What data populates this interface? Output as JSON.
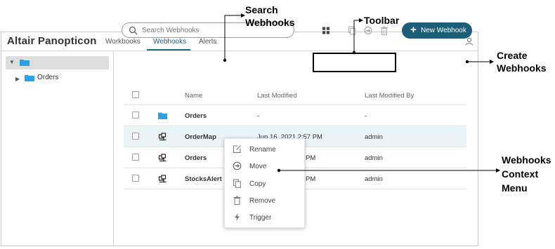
{
  "header": {
    "brand": "Altair Panopticon",
    "tabs": [
      {
        "label": "Workbooks",
        "active": false
      },
      {
        "label": "Webhooks",
        "active": true
      },
      {
        "label": "Alerts",
        "active": false
      }
    ],
    "user_icon": "user-icon"
  },
  "sidebar": {
    "root_icon": "folder-icon",
    "items": [
      {
        "label": "Orders",
        "icon": "folder-icon"
      }
    ]
  },
  "search": {
    "placeholder": "Search Webhooks",
    "value": ""
  },
  "toolbar": {
    "icons": [
      "grid-view-icon",
      "copy-icon",
      "move-icon",
      "trash-icon"
    ],
    "new_button_label": "New Webhook"
  },
  "table": {
    "columns": [
      "Name",
      "Last Modified",
      "Last Modified By"
    ],
    "rows": [
      {
        "type": "folder",
        "name": "Orders",
        "modified": "-",
        "modified_by": "-"
      },
      {
        "type": "webhook",
        "name": "OrderMap",
        "modified": "Jun 16, 2021 2:57 PM",
        "modified_by": "admin"
      },
      {
        "type": "webhook",
        "name": "Orders",
        "modified": "PM",
        "modified_by": "admin"
      },
      {
        "type": "webhook",
        "name": "StocksAlert",
        "modified": "PM",
        "modified_by": "admin"
      }
    ]
  },
  "context_menu": {
    "items": [
      {
        "label": "Rename",
        "icon": "rename-icon"
      },
      {
        "label": "Move",
        "icon": "move-icon"
      },
      {
        "label": "Copy",
        "icon": "copy-icon"
      },
      {
        "label": "Remove",
        "icon": "trash-icon"
      },
      {
        "label": "Trigger",
        "icon": "lightning-icon"
      }
    ]
  },
  "callouts": {
    "search": [
      "Search",
      "Webhooks"
    ],
    "toolbar": "Toolbar",
    "create": [
      "Create",
      "Webhooks"
    ],
    "context_menu": [
      "Webhooks",
      "Context",
      "Menu"
    ]
  },
  "colors": {
    "accent": "#1c5e78",
    "selected_row": "#eaf4f6",
    "folder": "#29a3e6"
  }
}
